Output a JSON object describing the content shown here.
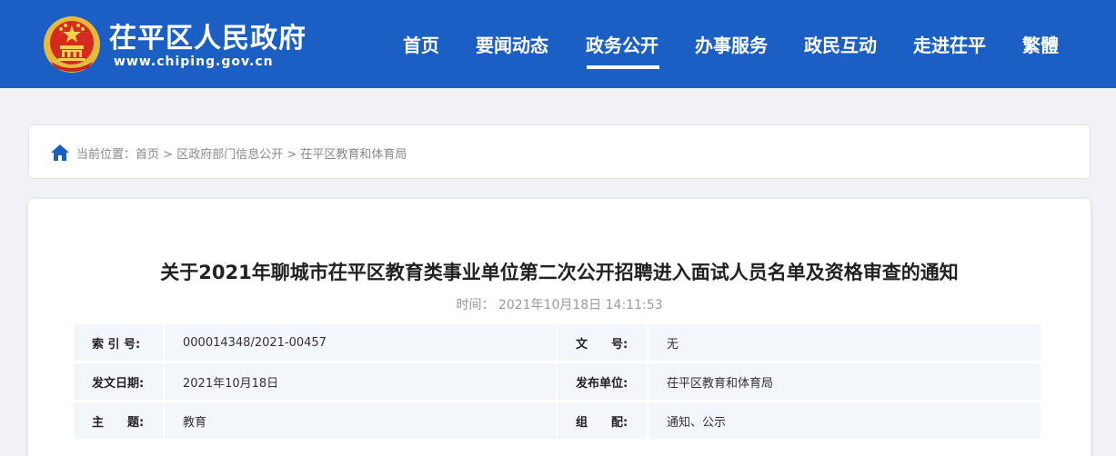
{
  "header": {
    "site_title": "茌平区人民政府",
    "site_url": "www.chiping.gov.cn",
    "nav": [
      "首页",
      "要闻动态",
      "政务公开",
      "办事服务",
      "政民互动",
      "走进茌平",
      "繁體"
    ],
    "active_nav": "政务公开",
    "bg_color": "#1b5fc4"
  },
  "breadcrumb": {
    "prefix": "当前位置：",
    "items": [
      "首页",
      "区政府部门信息公开",
      "茌平区教育和体育局"
    ],
    "separator": " > ",
    "icon": "home-icon"
  },
  "article": {
    "title": "关于2021年聊城市茌平区教育类事业单位第二次公开招聘进入面试人员名单及资格审查的通知",
    "time_label": "时间：",
    "time_value": "2021年10月18日 14:11:53"
  },
  "meta": {
    "index_label": "索 引 号:",
    "index_value": "000014348/2021-00457",
    "doc_no_label": "文　　号:",
    "doc_no_value": "无",
    "date_label": "发文日期:",
    "date_value": "2021年10月18日",
    "publisher_label": "发布单位:",
    "publisher_value": "茌平区教育和体育局",
    "topic_label": "主　　题:",
    "topic_value": "教育",
    "category_label": "组　　配:",
    "category_value": "通知、公示"
  }
}
